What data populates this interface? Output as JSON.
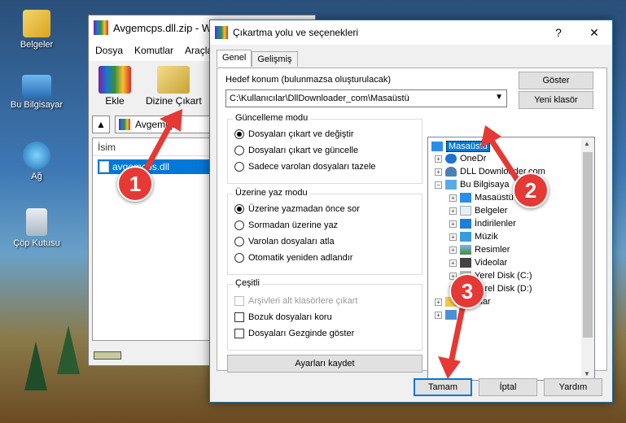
{
  "desktop": {
    "icons": [
      {
        "label": "Belgeler",
        "icon": "documents-folder-icon"
      },
      {
        "label": "Bu Bilgisayar",
        "icon": "computer-icon"
      },
      {
        "label": "Ağ",
        "icon": "network-icon"
      },
      {
        "label": "Çöp Kutusu",
        "icon": "recycle-bin-icon"
      }
    ]
  },
  "winrar": {
    "title": "Avgemcps.dll.zip - W",
    "menu": [
      "Dosya",
      "Komutlar",
      "Araçla"
    ],
    "tools": [
      {
        "label": "Ekle",
        "icon": "add-archive-icon"
      },
      {
        "label": "Dizine Çıkart",
        "icon": "extract-to-icon"
      }
    ],
    "path_text": "Avgemcps",
    "column_header": "İsim",
    "file_row": "avgemcps.dll"
  },
  "dialog": {
    "title": "Çıkartma yolu ve seçenekleri",
    "help_label": "?",
    "close_label": "✕",
    "tabs": [
      "Genel",
      "Gelişmiş"
    ],
    "dest_label": "Hedef konum (bulunmazsa oluşturulacak)",
    "dest_value": "C:\\Kullanıcılar\\DllDownloader_com\\Masaüstü",
    "show_button": "Göster",
    "new_folder_button": "Yeni klasör",
    "update_group": {
      "title": "Güncelleme modu",
      "options": [
        "Dosyaları çıkart ve değiştir",
        "Dosyaları çıkart ve güncelle",
        "Sadece varolan dosyaları tazele"
      ],
      "selected": 0
    },
    "overwrite_group": {
      "title": "Üzerine yaz modu",
      "options": [
        "Üzerine yazmadan önce sor",
        "Sormadan üzerine yaz",
        "Varolan dosyaları atla",
        "Otomatik yeniden adlandır"
      ],
      "selected": 0
    },
    "misc_group": {
      "title": "Çeşitli",
      "options": [
        "Arşivleri alt klasörlere çıkart",
        "Bozuk dosyaları koru",
        "Dosyaları Gezginde göster"
      ]
    },
    "save_settings_button": "Ayarları kaydet",
    "tree": [
      {
        "label": "Masaüstü",
        "icon": "desktop-icon"
      },
      {
        "label": "OneDr",
        "icon": "onedrive-icon"
      },
      {
        "label": "DLL Downloader.com",
        "icon": "user-icon"
      },
      {
        "label": "Bu Bilgisaya",
        "icon": "computer-icon"
      },
      {
        "label": "Masaüstü",
        "icon": "desktop-icon"
      },
      {
        "label": "Belgeler",
        "icon": "documents-icon"
      },
      {
        "label": "İndirilenler",
        "icon": "downloads-icon"
      },
      {
        "label": "Müzik",
        "icon": "music-icon"
      },
      {
        "label": "Resimler",
        "icon": "pictures-icon"
      },
      {
        "label": "Videolar",
        "icon": "videos-icon"
      },
      {
        "label": "Yerel Disk (C:)",
        "icon": "drive-icon"
      },
      {
        "label": "Yerel Disk (D:)",
        "icon": "drive-icon"
      },
      {
        "label": "klar",
        "icon": "folder-icon"
      },
      {
        "label": "",
        "icon": "network-icon"
      }
    ],
    "ok_button": "Tamam",
    "cancel_button": "İptal",
    "help_button": "Yardım"
  },
  "annotations": [
    "1",
    "2",
    "3"
  ],
  "colors": {
    "accent": "#0078d7",
    "badge": "#e53935"
  }
}
